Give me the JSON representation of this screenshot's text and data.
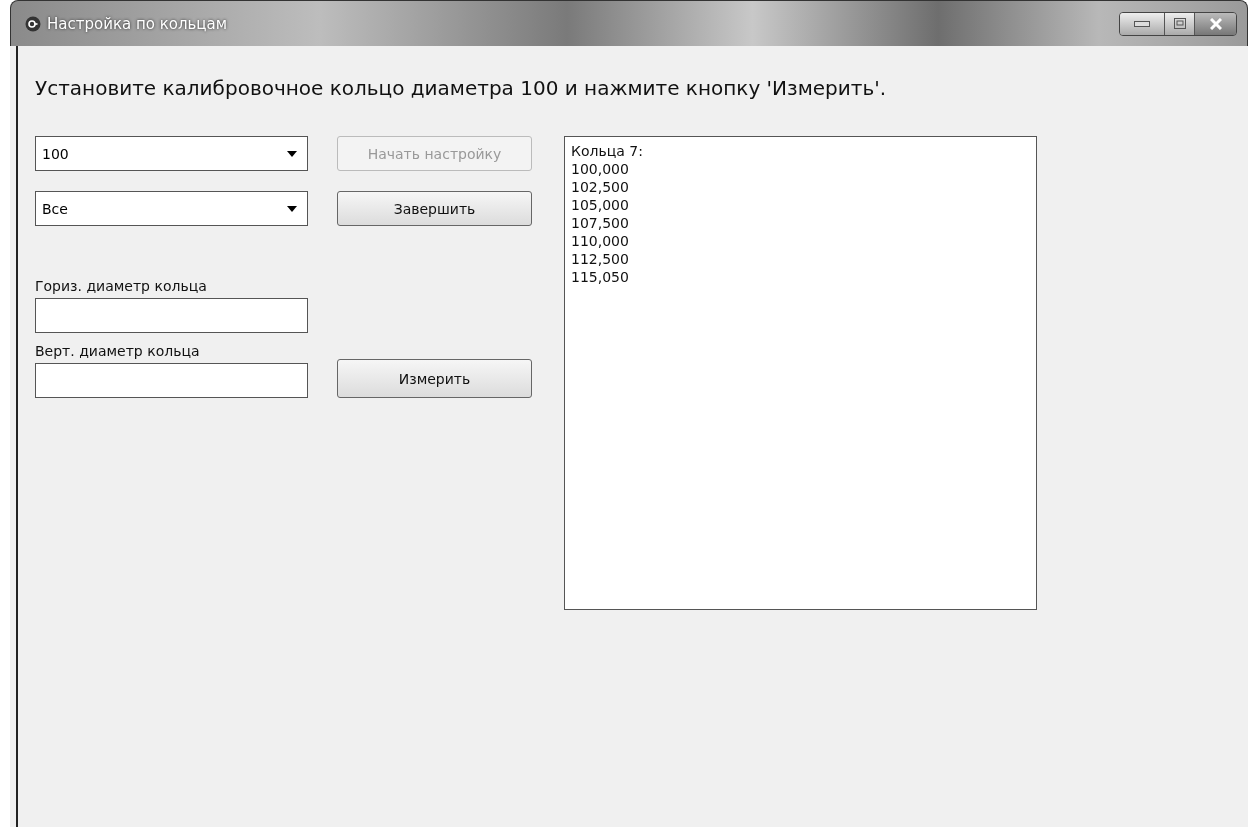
{
  "window": {
    "title": "Настройка по кольцам"
  },
  "instruction": "Установите калибровочное кольцо диаметра 100 и нажмите кнопку 'Измерить'.",
  "dropdowns": [
    {
      "value": "100"
    },
    {
      "value": "Все"
    }
  ],
  "buttons": [
    {
      "label": "Начать настройку",
      "disabled": true
    },
    {
      "label": "Завершить",
      "disabled": false
    }
  ],
  "fields": [
    {
      "label": "Гориз. диаметр кольца"
    },
    {
      "label": "Верт. диаметр кольца"
    }
  ],
  "measure_button": {
    "label": "Измерить",
    "disabled": false
  },
  "rings_list": {
    "lines": [
      "Кольца 7:",
      "100,000",
      "102,500",
      "105,000",
      "107,500",
      "110,000",
      "112,500",
      "115,050"
    ]
  }
}
